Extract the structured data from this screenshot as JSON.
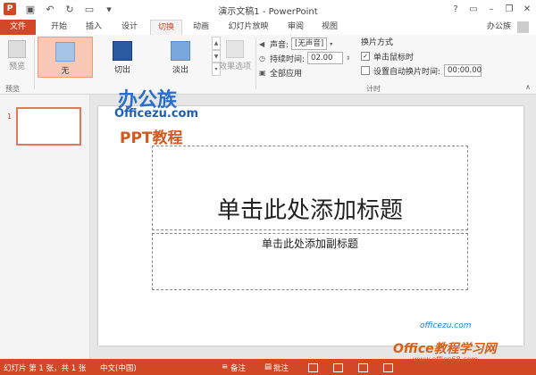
{
  "window": {
    "title": "演示文稿1 - PowerPoint",
    "app_badge": "P",
    "account": "办公族"
  },
  "tabs": [
    "文件",
    "开始",
    "插入",
    "设计",
    "切换",
    "动画",
    "幻灯片放映",
    "审阅",
    "视图"
  ],
  "ribbon": {
    "preview": "预览",
    "preview_group": "预览",
    "gallery": [
      "无",
      "切出",
      "淡出"
    ],
    "effect_options": "效果选项",
    "sound_label": "声音:",
    "sound_value": "[无声音]",
    "duration_label": "持续时间:",
    "duration_value": "02.00",
    "apply_all": "全部应用",
    "advance_title": "换片方式",
    "on_click": "单击鼠标时",
    "after_label": "设置自动换片时间:",
    "after_value": "00:00.00",
    "timing_group": "计时"
  },
  "slides_pane": {
    "slide_number": "1"
  },
  "slide": {
    "title_placeholder": "单击此处添加标题",
    "subtitle_placeholder": "单击此处添加副标题"
  },
  "watermark": {
    "brand": "办公族",
    "site": "Officezu.com",
    "tag": "PPT教程",
    "bottom_site": "officezu.com",
    "bottom_brand": "Office教程学习网",
    "bottom_url": "www.office68.com"
  },
  "status": {
    "slide_info": "幻灯片 第 1 张，共 1 张",
    "language": "中文(中国)",
    "notes": "备注",
    "comments": "批注"
  }
}
